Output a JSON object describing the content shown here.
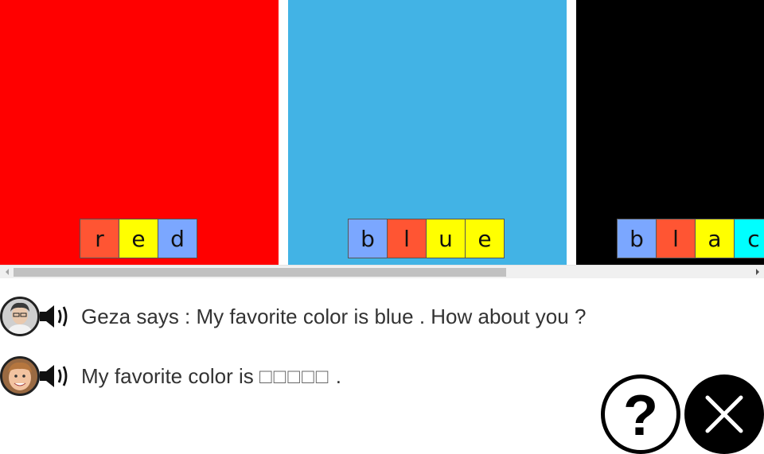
{
  "cards": [
    {
      "name": "red",
      "color": "#ff0000",
      "letters": [
        {
          "char": "r",
          "color": "#ff5533"
        },
        {
          "char": "e",
          "color": "#ffff00"
        },
        {
          "char": "d",
          "color": "#7ba7ff"
        }
      ]
    },
    {
      "name": "blue",
      "color": "#42b3e5",
      "letters": [
        {
          "char": "b",
          "color": "#7ba7ff"
        },
        {
          "char": "l",
          "color": "#ff5533"
        },
        {
          "char": "u",
          "color": "#ffff00"
        },
        {
          "char": "e",
          "color": "#ffff00"
        }
      ]
    },
    {
      "name": "black",
      "color": "#000000",
      "letters": [
        {
          "char": "b",
          "color": "#7ba7ff"
        },
        {
          "char": "l",
          "color": "#ff5533"
        },
        {
          "char": "a",
          "color": "#ffff00"
        },
        {
          "char": "c",
          "color": "#00ffff"
        }
      ]
    }
  ],
  "dialogue": {
    "line1": {
      "speaker": "Geza",
      "text": "Geza says : My favorite color is blue . How about you ?",
      "avatar_icon": "man-avatar-icon",
      "audio_icon": "speaker-icon"
    },
    "line2": {
      "prefix": "My favorite color is",
      "blanks": "□□□□□",
      "suffix": ".",
      "avatar_icon": "boy-avatar-icon",
      "audio_icon": "speaker-icon"
    }
  },
  "buttons": {
    "help": {
      "icon": "question-mark-icon",
      "symbol": "?"
    },
    "close": {
      "icon": "close-x-icon"
    }
  },
  "colors": {
    "help_bg": "#ffffff",
    "close_bg": "#000000",
    "text": "#333333"
  }
}
